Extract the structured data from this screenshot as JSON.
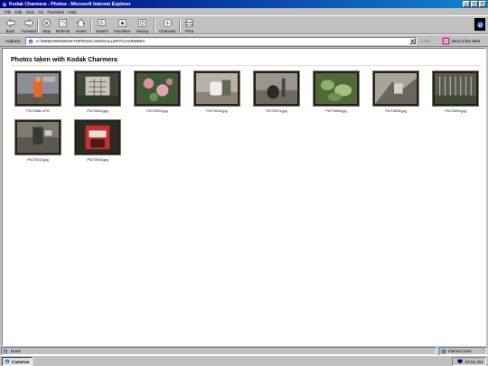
{
  "window": {
    "title": "Kodak Charmera - Photos - Microsoft Internet Explorer",
    "buttons": [
      "_",
      "□",
      "×"
    ]
  },
  "menu": [
    "File",
    "Edit",
    "View",
    "Go",
    "Favorites",
    "Help"
  ],
  "toolbar": {
    "back": "Back",
    "forward": "Forward",
    "stop": "Stop",
    "refresh": "Refresh",
    "home": "Home",
    "search": "Search",
    "favorites": "Favorites",
    "history": "History",
    "channels": "Channels",
    "print": "Print"
  },
  "address": {
    "label": "Address",
    "value": "C:\\WINDOWS\\DESKTOP\\DIGICAMS\\GALLERY\\CHARMERA",
    "links": "Links",
    "best_of_web": "Best of the Web"
  },
  "page": {
    "heading": "Photos taken with Kodak Charmera",
    "photos": [
      {
        "filename": "PICT0081.JPG"
      },
      {
        "filename": "PICT0023.jpg"
      },
      {
        "filename": "PICT0029.jpg"
      },
      {
        "filename": "PICT0034.jpg"
      },
      {
        "filename": "PICT0074.jpg"
      },
      {
        "filename": "PICT0006.jpg"
      },
      {
        "filename": "PICT0028.jpg"
      },
      {
        "filename": "PICT0009.jpg"
      },
      {
        "filename": "PICT0013.jpg"
      },
      {
        "filename": "PICT0016.jpg"
      }
    ]
  },
  "status": {
    "text": "Done",
    "zone": "Internet zone"
  },
  "taskbar": {
    "task": "Cameras",
    "clock": "03:01 AM"
  }
}
